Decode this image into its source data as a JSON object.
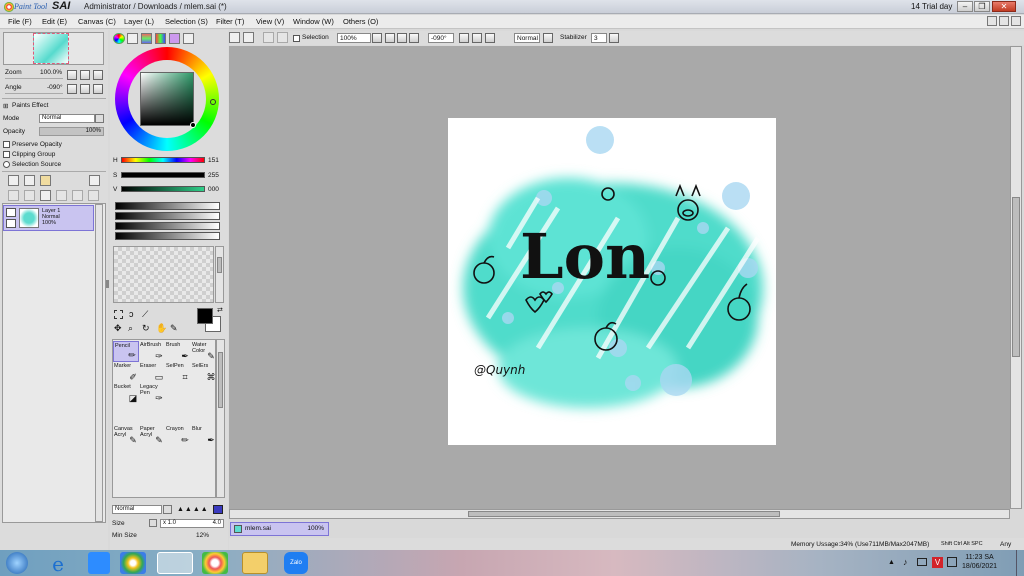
{
  "window": {
    "app_logo_prefix": "Paint Tool",
    "app_logo_name": "SAI",
    "title": "Administrator / Downloads / mlem.sai (*)",
    "trial": "14 Trial day"
  },
  "menu": [
    "File (F)",
    "Edit (E)",
    "Canvas (C)",
    "Layer (L)",
    "Selection (S)",
    "Filter (T)",
    "View (V)",
    "Window (W)",
    "Others (O)"
  ],
  "navigator": {
    "zoom_label": "Zoom",
    "zoom_value": "100.0%",
    "angle_label": "Angle",
    "angle_value": "-090°"
  },
  "layer_panel": {
    "paint_effect": "Paints Effect",
    "mode_label": "Mode",
    "mode_value": "Normal",
    "opacity_label": "Opacity",
    "opacity_value": "100%",
    "preserve_opacity": "Preserve Opacity",
    "clipping_group": "Clipping Group",
    "selection_source": "Selection Source",
    "layer_name": "Layer 1",
    "layer_mode": "Normal",
    "layer_opacity": "100%"
  },
  "color": {
    "h_label": "H",
    "h_value": "151",
    "s_label": "S",
    "s_value": "255",
    "v_label": "V",
    "v_value": "000",
    "foreground": "#000000",
    "background": "#ffffff"
  },
  "tools": [
    {
      "label": "Pencil",
      "icon": "pencil-icon"
    },
    {
      "label": "AirBrush",
      "icon": "airbrush-icon"
    },
    {
      "label": "Brush",
      "icon": "brush-icon"
    },
    {
      "label": "Water Color",
      "icon": "watercolor-icon"
    },
    {
      "label": "Marker",
      "icon": "marker-icon"
    },
    {
      "label": "Eraser",
      "icon": "eraser-icon"
    },
    {
      "label": "SelPen",
      "icon": "selpen-icon"
    },
    {
      "label": "SelErs",
      "icon": "selers-icon"
    },
    {
      "label": "Bucket",
      "icon": "bucket-icon"
    },
    {
      "label": "Legacy Pen",
      "icon": "legacy-pen-icon"
    },
    {
      "label": "Canvas Acryl",
      "icon": "canvas-acryl-icon"
    },
    {
      "label": "Paper Acryl",
      "icon": "paper-acryl-icon"
    },
    {
      "label": "Crayon",
      "icon": "crayon-icon"
    },
    {
      "label": "Blur",
      "icon": "blur-icon"
    }
  ],
  "brush": {
    "blend_mode": "Normal",
    "size_label": "Size",
    "size_multiplier": "x 1.0",
    "size_value": "4.0",
    "min_size_label": "Min Size",
    "min_size_value": "12%"
  },
  "toolbar": {
    "selection_label": "Selection",
    "zoom": "100%",
    "angle": "-090°",
    "blend": "Normal",
    "stabilizer_label": "Stabilizer",
    "stabilizer_value": "3"
  },
  "artwork": {
    "main_text": "Lon",
    "signature": "@Quynh"
  },
  "document_tab": {
    "name": "mlem.sai",
    "zoom": "100%"
  },
  "status": {
    "memory": "Memory Ussage:34% (Use711MB/Max2047MB)",
    "keys": "Shift Ctrl Alt SPC",
    "ime": "Any"
  },
  "taskbar": {
    "time": "11:23 SA",
    "date": "18/06/2021",
    "zalo_label": "Zalo"
  }
}
